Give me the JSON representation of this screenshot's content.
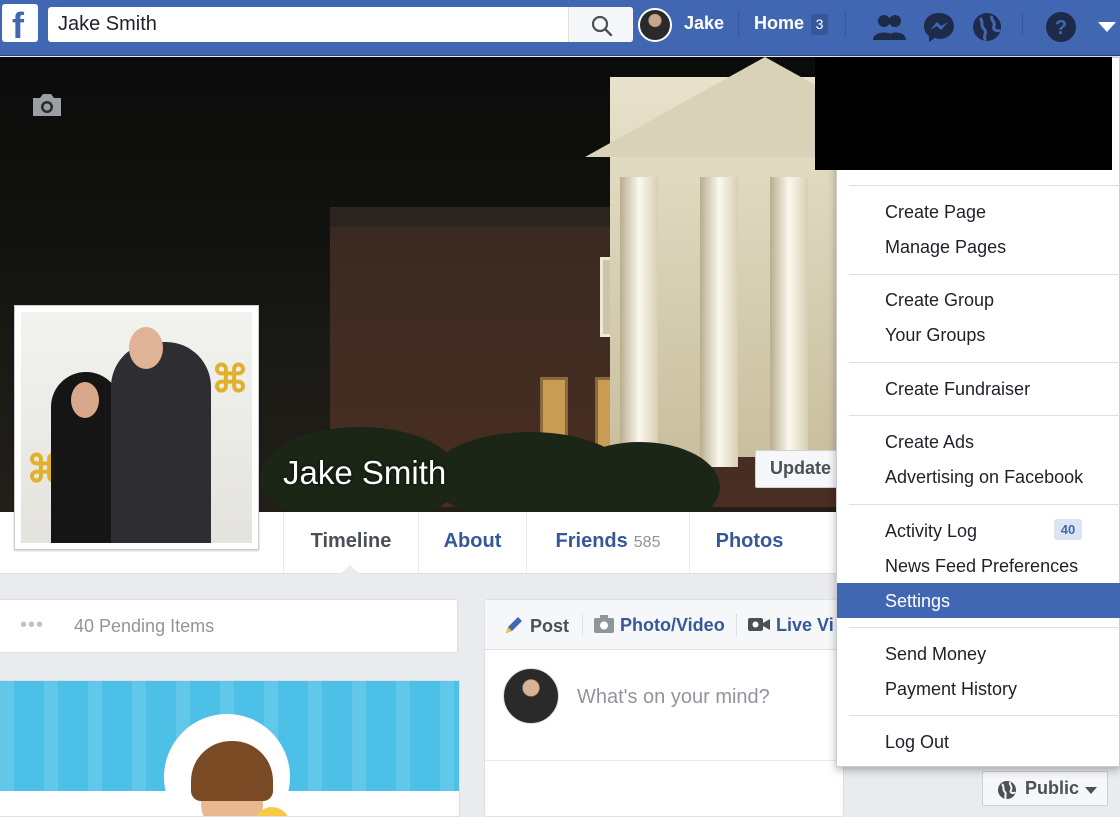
{
  "colors": {
    "brand_blue": "#4267b2",
    "link_blue": "#365899",
    "bg_gray": "#e9ebee"
  },
  "topbar": {
    "logo_letter": "f",
    "search": {
      "value": "Jake Smith",
      "icon": "search-icon"
    },
    "user_name": "Jake",
    "home_label": "Home",
    "home_count": "3",
    "icons": [
      "friend-requests-icon",
      "messenger-icon",
      "notifications-globe-icon",
      "help-icon",
      "account-menu-caret-icon"
    ]
  },
  "cover": {
    "name": "Jake Smith",
    "update_button": "Update",
    "camera_icon": "camera-icon"
  },
  "profile_tabs": [
    {
      "label": "Timeline"
    },
    {
      "label": "About"
    },
    {
      "label": "Friends",
      "count": "585"
    },
    {
      "label": "Photos"
    }
  ],
  "pending": {
    "label": "40 Pending Items"
  },
  "composer": {
    "tabs": [
      {
        "label": "Post",
        "icon": "pencil-icon"
      },
      {
        "label": "Photo/Video",
        "icon": "camera-icon"
      },
      {
        "label": "Live Vi",
        "icon": "video-icon"
      }
    ],
    "placeholder": "What's on your mind?",
    "audience": "Public"
  },
  "dropdown": {
    "items": [
      {
        "label": "Create Page"
      },
      {
        "label": "Manage Pages"
      },
      {
        "label": "Create Group"
      },
      {
        "label": "Your Groups"
      },
      {
        "label": "Create Fundraiser"
      },
      {
        "label": "Create Ads"
      },
      {
        "label": "Advertising on Facebook"
      },
      {
        "label": "Activity Log",
        "badge": "40"
      },
      {
        "label": "News Feed Preferences"
      },
      {
        "label": "Settings",
        "selected": true
      },
      {
        "label": "Send Money"
      },
      {
        "label": "Payment History"
      },
      {
        "label": "Log Out"
      }
    ]
  }
}
